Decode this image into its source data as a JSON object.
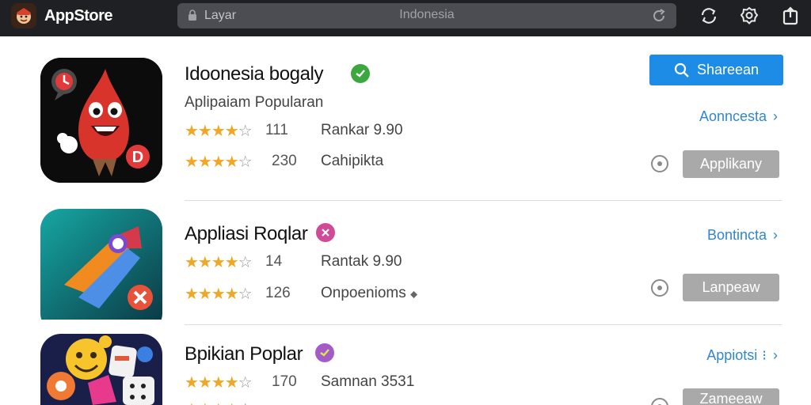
{
  "topbar": {
    "app_name": "AppStore",
    "search_placeholder": "Layar",
    "url_text": "Indonesia"
  },
  "primary_button": {
    "label": "Shareean"
  },
  "apps": [
    {
      "title": "Idoonesia bogaly",
      "subtitle": "Aplipaiam Popularan",
      "rating_1": {
        "stars": 4.5,
        "count": "111",
        "meta": "Rankar 9.90"
      },
      "rating_2": {
        "stars": 4.5,
        "count": "230",
        "meta": "Cahipikta"
      },
      "link": "Aonncesta",
      "button": "Applikany",
      "badge_color": "#3aa83f"
    },
    {
      "title": "Appliasi Roqlar",
      "rating_1": {
        "stars": 4.5,
        "count": "14",
        "meta": "Rantak 9.90"
      },
      "rating_2": {
        "stars": 4.5,
        "count": "126",
        "meta": "Onpoenioms"
      },
      "link": "Bontincta",
      "button": "Lanpeaw",
      "badge_color": "#d04a98"
    },
    {
      "title": "Bpikian Poplar",
      "rating_1": {
        "stars": 4.5,
        "count": "170",
        "meta": "Samnan 3531"
      },
      "link": "Appiotsi",
      "button": "Zameeaw",
      "badge_color": "#a35cc7"
    }
  ]
}
